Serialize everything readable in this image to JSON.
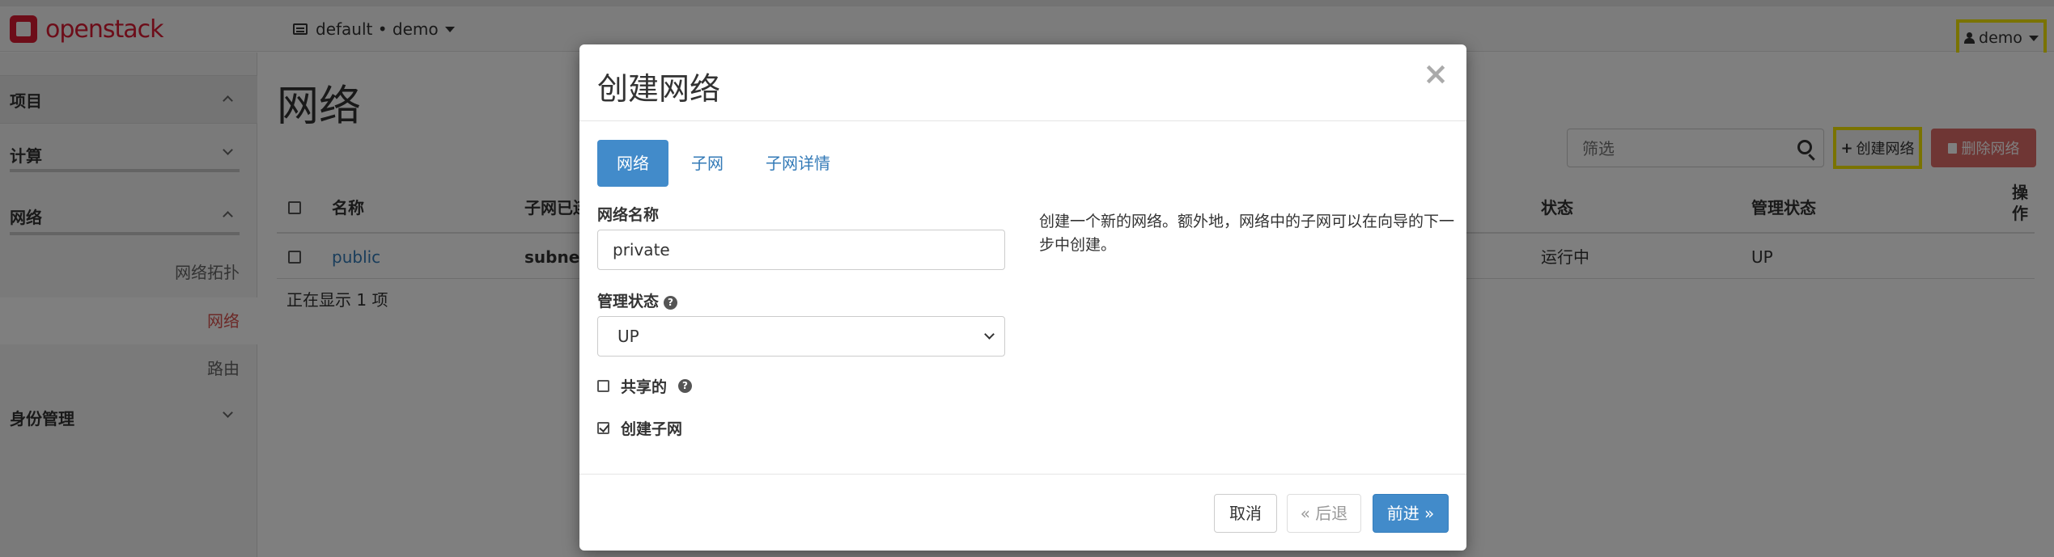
{
  "navbar": {
    "brand": "openstack",
    "project_selector": "default • demo",
    "user": "demo"
  },
  "sidebar": {
    "project": "项目",
    "compute": "计算",
    "network": "网络",
    "network_items": [
      "网络拓扑",
      "网络",
      "路由"
    ],
    "identity": "身份管理"
  },
  "page": {
    "title": "网络",
    "filter_placeholder": "筛选",
    "create_button": "创建网络",
    "delete_button": "删除网络",
    "columns": {
      "name": "名称",
      "subnets": "子网已连",
      "status": "状态",
      "admin_state": "管理状态",
      "actions": "操作"
    },
    "rows": [
      {
        "name": "public",
        "subnets": "subnet",
        "status": "运行中",
        "admin_state": "UP"
      }
    ],
    "count_text": "正在显示 1 项"
  },
  "modal": {
    "title": "创建网络",
    "close": "×",
    "tabs": [
      "网络",
      "子网",
      "子网详情"
    ],
    "name_label": "网络名称",
    "name_value": "private",
    "admin_state_label": "管理状态",
    "admin_state_value": "UP",
    "shared_label": "共享的",
    "shared_checked": false,
    "create_subnet_label": "创建子网",
    "create_subnet_checked": true,
    "help_text": "创建一个新的网络。额外地，网络中的子网可以在向导的下一步中创建。",
    "cancel": "取消",
    "back": "« 后退",
    "next": "前进 »"
  }
}
